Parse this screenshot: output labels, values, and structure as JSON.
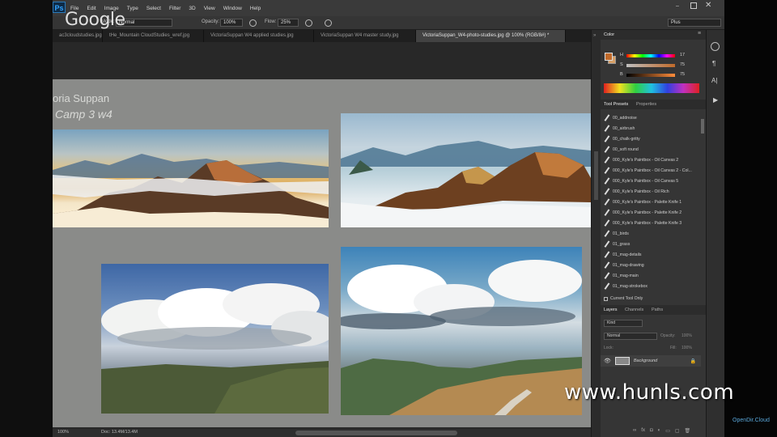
{
  "app": {
    "logo": "Ps",
    "menu": [
      "File",
      "Edit",
      "Image",
      "Type",
      "Select",
      "Filter",
      "3D",
      "View",
      "Window",
      "Help"
    ],
    "overlay_brand": "Google",
    "workspace_field": "Plus"
  },
  "options": {
    "mode_label": "Mode:",
    "mode_value": "Normal",
    "opacity_label": "Opacity:",
    "opacity_value": "100%",
    "flow_label": "Flow:",
    "flow_value": "25%"
  },
  "tabs": [
    "ac3cloudstudies.jpg",
    "tHe_Mountain CloudStudies_wref.jpg",
    "VictoriaSuppan W4 applied studies.jpg",
    "VictoriaSuppan W4 master study.jpg",
    "VictoriaSuppan_W4-photo-studies.jpg @ 100% (RGB/8#) *"
  ],
  "document": {
    "author": "oria Suppan",
    "subtitle": "Camp 3 w4"
  },
  "status": {
    "zoom": "100%",
    "doc_info": "Doc: 13.4M/13.4M"
  },
  "color_panel": {
    "title": "Color",
    "h_label": "H",
    "s_label": "S",
    "b_label": "B",
    "h_value": "17",
    "s_value": "75",
    "b_value": "75",
    "fg_color": "#c06a2a",
    "bg_color": "#d7a068"
  },
  "tool_presets": {
    "tab_active": "Tool Presets",
    "tab_other": "Properties",
    "items": [
      "00_addnoise",
      "00_airbrush",
      "00_chalk-gritty",
      "00_soft round",
      "000_Kyle's Paintbox - Oil Canvas 2",
      "000_Kyle's Paintbox - Oil Canvas 2 - Col...",
      "000_Kyle's Paintbox - Oil Canvas 5",
      "000_Kyle's Paintbox - Oil Rich",
      "000_Kyle's Paintbox - Palette Knife 1",
      "000_Kyle's Paintbox - Palette Knife 2",
      "000_Kyle's Paintbox - Palette Knife 3",
      "01_birds",
      "01_grass",
      "01_mag-details",
      "01_mag-drawing",
      "01_mag-main",
      "01_mag-strokebox"
    ],
    "current_tool_only": "Current Tool Only"
  },
  "layers": {
    "tabs": [
      "Layers",
      "Channels",
      "Paths"
    ],
    "kind_label": "Kind",
    "blend_mode": "Normal",
    "opacity_label": "Opacity:",
    "opacity_value": "100%",
    "lock_label": "Lock:",
    "fill_label": "Fill:",
    "fill_value": "100%",
    "layer_name": "Background"
  },
  "watermark": "www.hunls.com",
  "watermark_small": "OpenDir.Cloud"
}
